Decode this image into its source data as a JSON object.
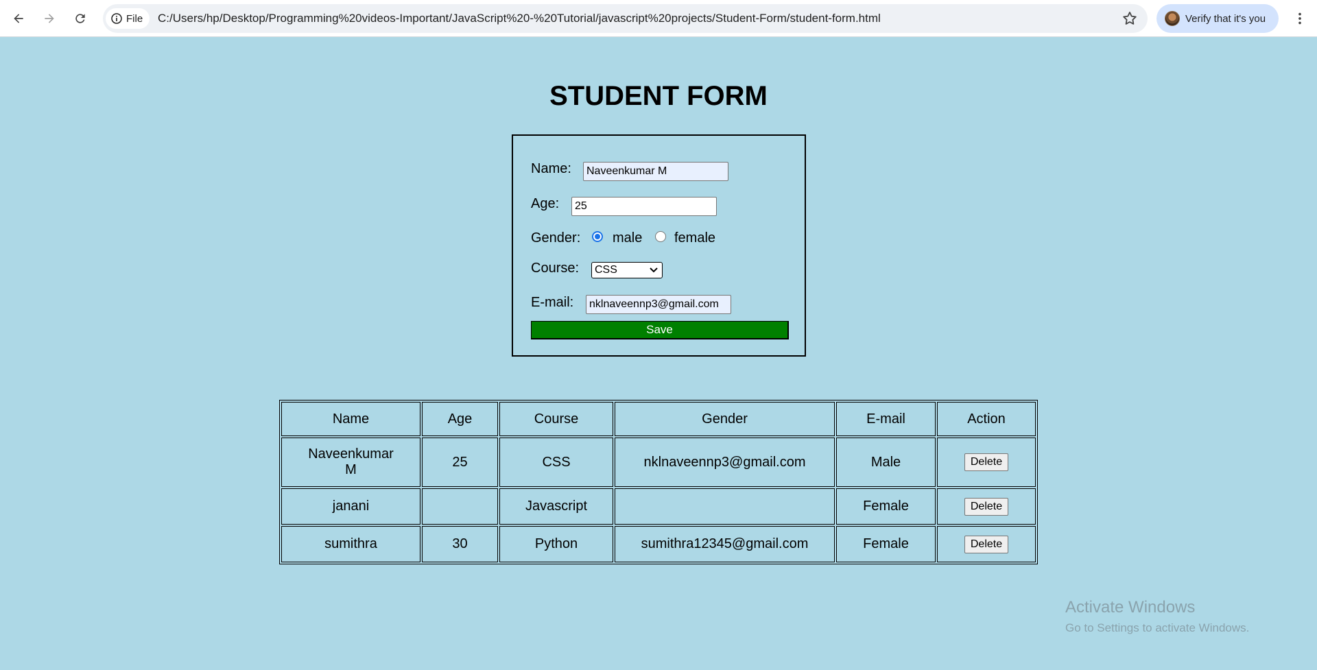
{
  "browser": {
    "site_chip_label": "File",
    "url": "C:/Users/hp/Desktop/Programming%20videos-Important/JavaScript%20-%20Tutorial/javascript%20projects/Student-Form/student-form.html",
    "profile_label": "Verify that it's you"
  },
  "page": {
    "title": "STUDENT FORM"
  },
  "form": {
    "name_label": "Name:",
    "name_value": "Naveenkumar M",
    "age_label": "Age:",
    "age_value": "25",
    "gender_label": "Gender:",
    "gender_options": [
      "male",
      "female"
    ],
    "gender_selected": "male",
    "course_label": "Course:",
    "course_selected": "CSS",
    "email_label": "E-mail:",
    "email_value": "nklnaveennp3@gmail.com",
    "save_label": "Save"
  },
  "table": {
    "headers": [
      "Name",
      "Age",
      "Course",
      "Gender",
      "E-mail",
      "Action"
    ],
    "rows": [
      {
        "name": "Naveenkumar M",
        "age": "25",
        "course": "CSS",
        "gender": "nklnaveennp3@gmail.com",
        "email": "Male",
        "action": "Delete"
      },
      {
        "name": "janani",
        "age": "",
        "course": "Javascript",
        "gender": "",
        "email": "Female",
        "action": "Delete"
      },
      {
        "name": "sumithra",
        "age": "30",
        "course": "Python",
        "gender": "sumithra12345@gmail.com",
        "email": "Female",
        "action": "Delete"
      }
    ]
  },
  "watermark": {
    "line1": "Activate Windows",
    "line2": "Go to Settings to activate Windows."
  },
  "colors": {
    "page_background": "#add8e6",
    "save_button": "#008000",
    "radio_accent": "#1a73e8"
  }
}
